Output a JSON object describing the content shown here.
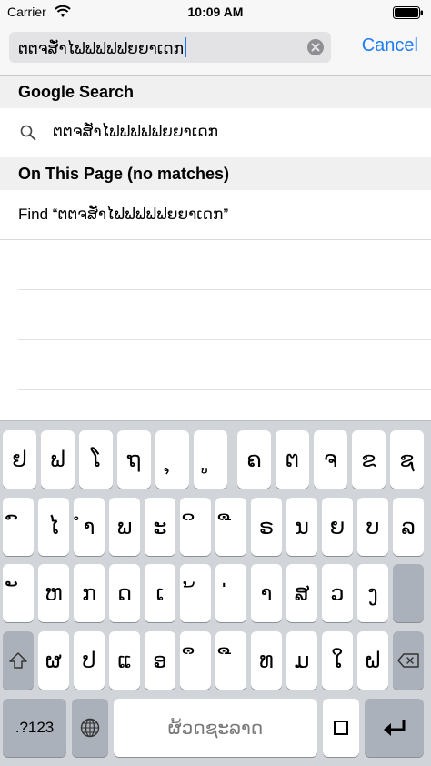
{
  "status_bar": {
    "carrier": "Carrier",
    "time": "10:09 AM"
  },
  "search": {
    "query": "ຕຕຈສັ່ໍາໄຟຟຟຟຟຍຍາເດກ",
    "cancel_label": "Cancel"
  },
  "results": {
    "google_header": "Google Search",
    "google_suggestion": "ຕຕຈສັ່ໍາໄຟຟຟຟຟຍຍາເດກ",
    "on_page_header": "On This Page (no matches)",
    "find_label": "Find “ຕຕຈສັ່ໍາໄຟຟຟຟຟຍຍາເດກ”"
  },
  "keyboard": {
    "row1": [
      "ຢ",
      "ຟ",
      "ໂ",
      "ຖ",
      "ຸ",
      "ູ",
      "ຄ",
      "ຕ",
      "ຈ",
      "ຂ",
      "ຊ"
    ],
    "row2": [
      "ົ",
      "ໄ",
      "ຳ",
      "ພ",
      "ະ",
      "ິ",
      "ື",
      "ຣ",
      "ນ",
      "ຍ",
      "ບ",
      "ລ"
    ],
    "row3": [
      "ັ",
      "ຫ",
      "ກ",
      "ດ",
      "ເ",
      "້",
      "່",
      "າ",
      "ສ",
      "ວ",
      "ງ"
    ],
    "row4": [
      "ຜ",
      "ປ",
      "ແ",
      "ອ",
      "ຶ",
      "ື",
      "ທ",
      "ມ",
      "ໃ",
      "ຝ"
    ],
    "numbers_label": ".?123",
    "space_label": "ຜ້ວດຊະລາດ"
  },
  "colors": {
    "accent": "#1e7cf6",
    "keyboard_bg": "#d1d4d9",
    "func_key": "#abb1ba"
  }
}
